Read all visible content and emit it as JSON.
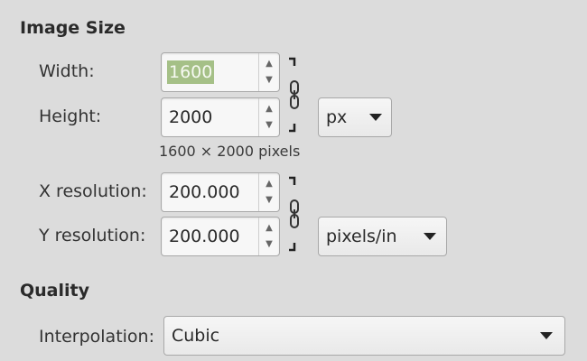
{
  "image_size": {
    "title": "Image Size",
    "width_label": "Width:",
    "width_value": "1600",
    "height_label": "Height:",
    "height_value": "2000",
    "size_unit": "px",
    "pixel_summary": "1600 × 2000 pixels",
    "xres_label": "X resolution:",
    "xres_value": "200.000",
    "yres_label": "Y resolution:",
    "yres_value": "200.000",
    "res_unit": "pixels/in"
  },
  "quality": {
    "title": "Quality",
    "interp_label": "Interpolation:",
    "interp_value": "Cubic"
  },
  "icons": {
    "spin_up": "triangle-up",
    "spin_down": "triangle-down",
    "chain": "chain-link",
    "dropdown": "triangle-down"
  },
  "colors": {
    "background": "#dcdcdc",
    "selection": "#a5c087"
  }
}
